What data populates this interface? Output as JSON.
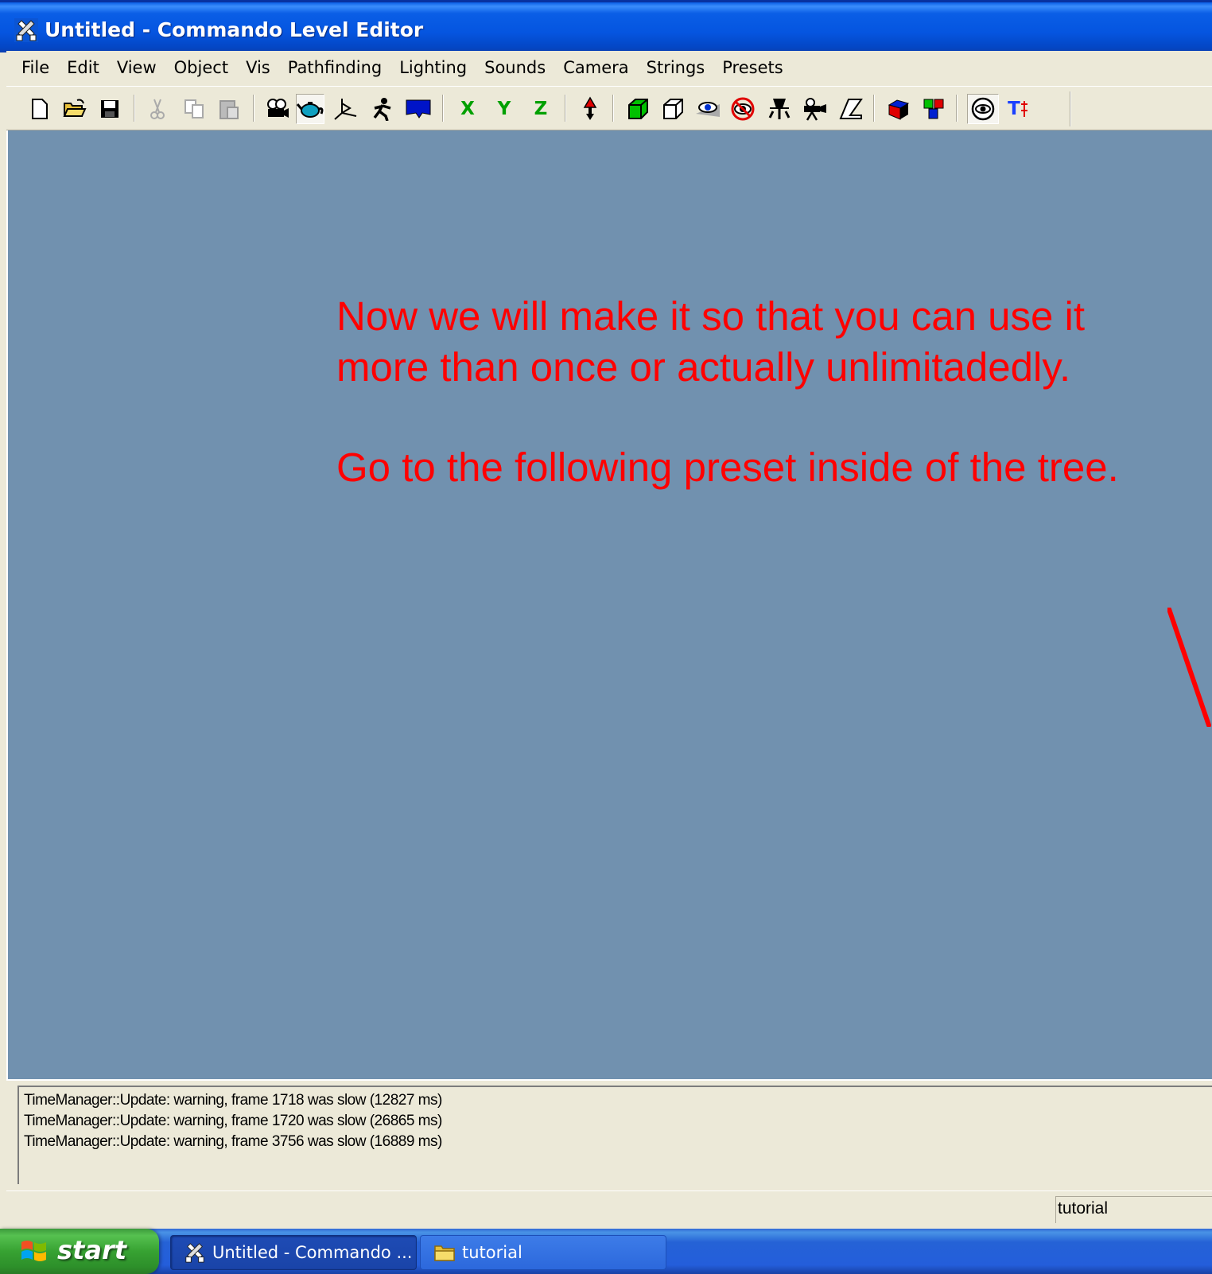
{
  "window": {
    "title": "Untitled - Commando Level Editor"
  },
  "menu": [
    "File",
    "Edit",
    "View",
    "Object",
    "Vis",
    "Pathfinding",
    "Lighting",
    "Sounds",
    "Camera",
    "Strings",
    "Presets"
  ],
  "toolbar": {
    "axis_x": "X",
    "axis_y": "Y",
    "axis_z": "Z",
    "tool_t_label": "T",
    "icons": [
      "new-file-icon",
      "open-folder-icon",
      "save-icon",
      "cut-icon",
      "copy-icon",
      "paste-icon",
      "camera-mode-icon",
      "teapot-object-icon",
      "axis-gizmo-icon",
      "walker-icon",
      "display-icon",
      "axis-x-icon",
      "axis-y-icon",
      "axis-z-icon",
      "drop-icon",
      "green-box-icon",
      "wire-box-icon",
      "eye-icon",
      "no-vis-icon",
      "light-icon",
      "camera-icon",
      "path-icon",
      "cube-color-icon",
      "color-blocks-icon",
      "eye-toggle-icon",
      "text-icon"
    ]
  },
  "viewport": {
    "background": "#7191af",
    "annotation_line1": "Now we will make it so that you can use it",
    "annotation_line2": "more than once or actually unlimitadedly.",
    "annotation_line3": "Go to the following preset inside of the tree.",
    "annotation_color": "#ff0000"
  },
  "output": {
    "lines": [
      "TimeManager::Update: warning, frame 1718 was slow (12827 ms)",
      "TimeManager::Update: warning, frame 1720 was slow (26865 ms)",
      "TimeManager::Update: warning, frame 3756 was slow (16889 ms)"
    ]
  },
  "statusbar": {
    "pane_text": "tutorial"
  },
  "taskbar": {
    "start_label": "start",
    "tasks": [
      {
        "label": "Untitled - Commando ...",
        "active": true
      },
      {
        "label": "tutorial",
        "active": false
      }
    ]
  }
}
